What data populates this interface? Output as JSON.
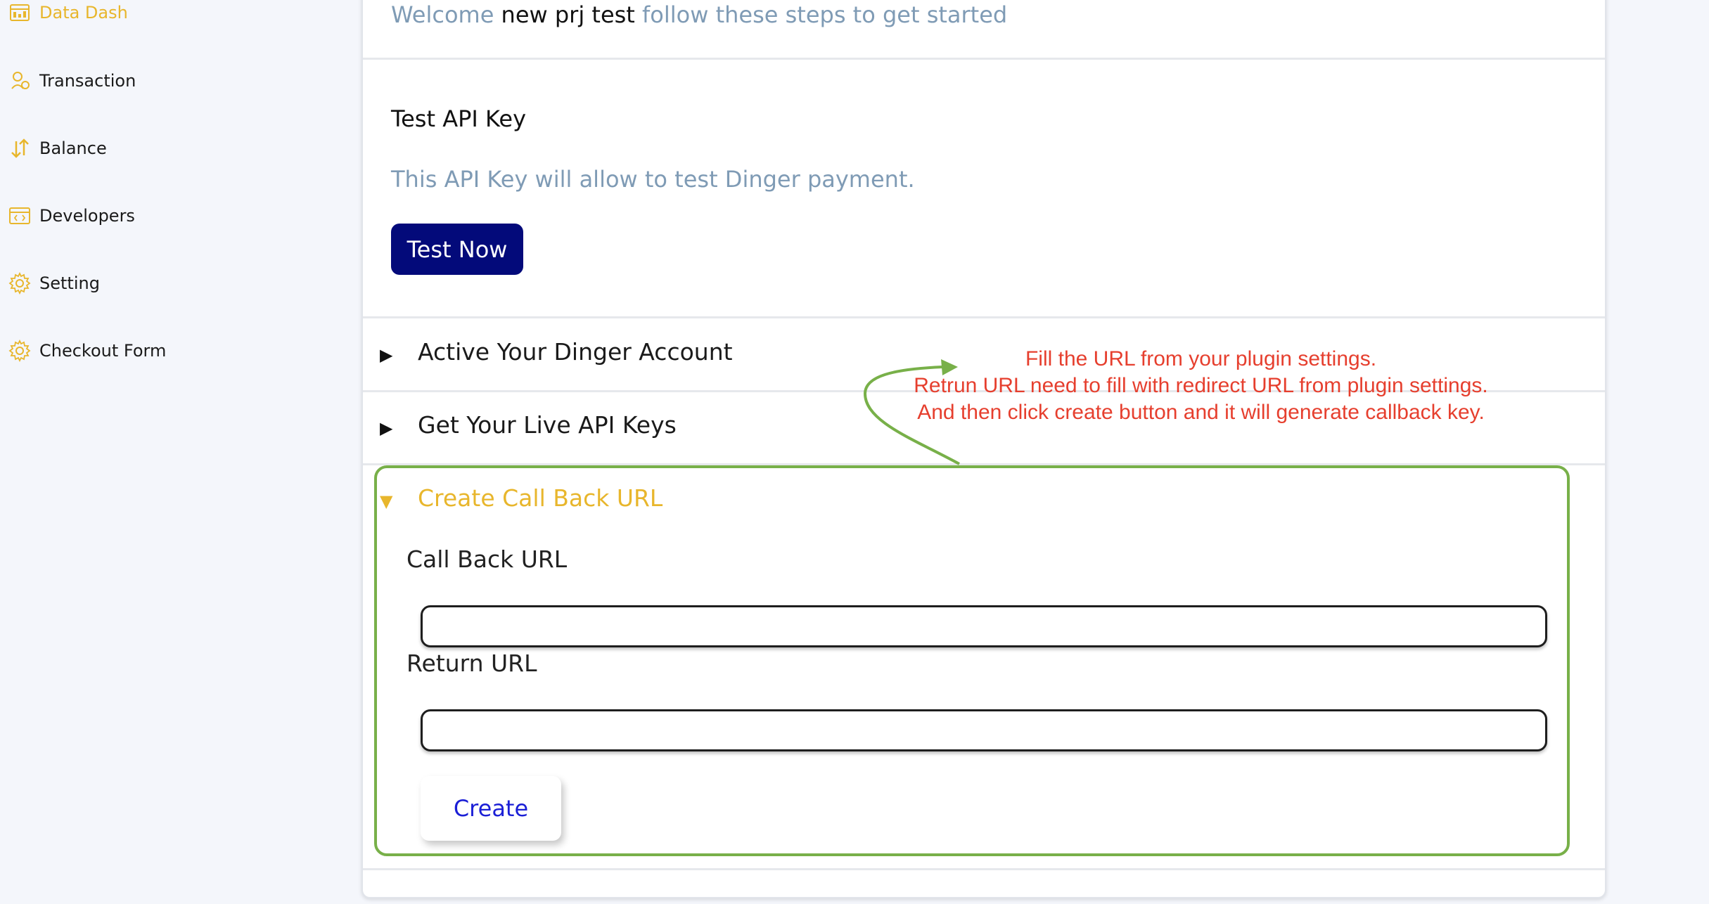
{
  "sidebar": {
    "items": [
      {
        "label": "Data Dash",
        "icon": "dashboard-icon",
        "active": true
      },
      {
        "label": "Transaction",
        "icon": "transaction-icon",
        "active": false
      },
      {
        "label": "Balance",
        "icon": "balance-arrows-icon",
        "active": false
      },
      {
        "label": "Developers",
        "icon": "code-window-icon",
        "active": false
      },
      {
        "label": "Setting",
        "icon": "gear-icon",
        "active": false
      },
      {
        "label": "Checkout Form",
        "icon": "gear-icon",
        "active": false
      }
    ]
  },
  "welcome": {
    "prefix": "Welcome",
    "project": "new prj test",
    "suffix": "follow these steps to get started"
  },
  "api_key": {
    "title": "Test API Key",
    "description": "This API Key will allow to test Dinger payment.",
    "test_button": "Test Now"
  },
  "accordion": {
    "items": [
      {
        "label": "Active Your Dinger Account",
        "open": false
      },
      {
        "label": "Get Your Live API Keys",
        "open": false
      },
      {
        "label": "Create Call Back URL",
        "open": true
      }
    ]
  },
  "callback_form": {
    "callback_label": "Call Back URL",
    "callback_value": "",
    "return_label": "Return URL",
    "return_value": "",
    "create_button": "Create"
  },
  "annotation": {
    "lines": [
      "Fill the URL from your plugin settings.",
      "Retrun URL need to fill with redirect URL from plugin settings.",
      "And then click create button and it will generate callback key."
    ]
  },
  "colors": {
    "accent_yellow": "#e8b62c",
    "muted_blue": "#7f9bb5",
    "primary_navy": "#030a7a",
    "link_blue": "#1b1fd6",
    "annotation_red": "#e63f2e",
    "annotation_green": "#78b049"
  }
}
